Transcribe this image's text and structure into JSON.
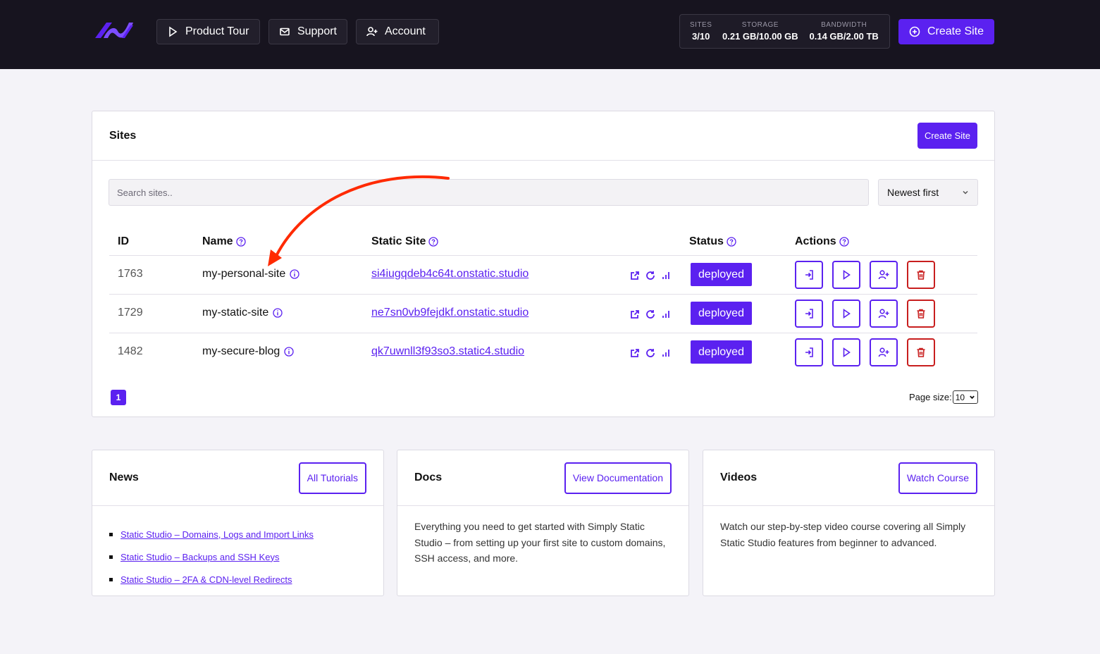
{
  "header": {
    "nav": [
      {
        "label": "Product Tour",
        "icon": "play-icon"
      },
      {
        "label": "Support",
        "icon": "mail-icon"
      },
      {
        "label": "Account",
        "icon": "user-plus-icon"
      }
    ],
    "stats": [
      {
        "label": "SITES",
        "value": "3/10"
      },
      {
        "label": "STORAGE",
        "value": "0.21 GB/10.00 GB"
      },
      {
        "label": "BANDWIDTH",
        "value": "0.14 GB/2.00 TB"
      }
    ],
    "create_label": "Create Site"
  },
  "sites": {
    "title": "Sites",
    "create_label": "Create Site",
    "search_placeholder": "Search sites..",
    "sort_value": "Newest first",
    "columns": {
      "id": "ID",
      "name": "Name",
      "static_site": "Static Site",
      "status": "Status",
      "actions": "Actions"
    },
    "rows": [
      {
        "id": "1763",
        "name": "my-personal-site",
        "url": "si4iugqdeb4c64t.onstatic.studio",
        "status": "deployed"
      },
      {
        "id": "1729",
        "name": "my-static-site",
        "url": "ne7sn0vb9fejdkf.onstatic.studio",
        "status": "deployed"
      },
      {
        "id": "1482",
        "name": "my-secure-blog",
        "url": "qk7uwnll3f93so3.static4.studio",
        "status": "deployed"
      }
    ],
    "page": "1",
    "page_size_label": "Page size:",
    "page_size": "10"
  },
  "news": {
    "title": "News",
    "button": "All Tutorials",
    "items": [
      "Static Studio – Domains, Logs and Import Links",
      "Static Studio – Backups and SSH Keys",
      "Static Studio – 2FA & CDN-level Redirects"
    ]
  },
  "docs": {
    "title": "Docs",
    "button": "View Documentation",
    "text": "Everything you need to get started with Simply Static Studio – from setting up your first site to custom domains, SSH access, and more."
  },
  "videos": {
    "title": "Videos",
    "button": "Watch Course",
    "text": "Watch our step-by-step video course covering all Simply Static Studio features from beginner to advanced."
  },
  "colors": {
    "accent": "#5b21f0",
    "danger": "#c81e1e",
    "header_bg": "#17141f",
    "annotation": "#ff2a00"
  }
}
